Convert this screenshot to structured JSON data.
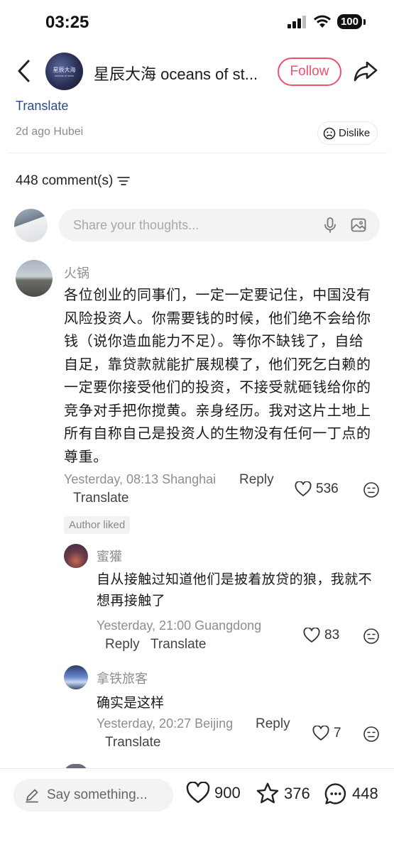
{
  "status_bar": {
    "time": "03:25",
    "battery": "100"
  },
  "header": {
    "avatar_logo_text": "星辰大海",
    "avatar_logo_sub": "oceans of stars",
    "title": "星辰大海 oceans of st...",
    "follow_label": "Follow"
  },
  "post": {
    "translate_label": "Translate",
    "meta": "2d ago Hubei",
    "dislike_label": "Dislike"
  },
  "comments_header": {
    "count_label": "448 comment(s)"
  },
  "composer": {
    "placeholder": "Share your thoughts..."
  },
  "comments": [
    {
      "user": "火锅",
      "body": "各位创业的同事们，一定一定要记住，中国没有风险投资人。你需要钱的时候，他们绝不会给你钱（说你造血能力不足）。等你不缺钱了，自给自足，靠贷款就能扩展规模了，他们死乞白赖的一定要你接受他们的投资，不接受就砸钱给你的竞争对手把你搅黄。亲身经历。我对这片土地上所有自称自己是投资人的生物没有任何一丁点的尊重。",
      "meta": "Yesterday, 08:13 Shanghai",
      "reply_label": "Reply",
      "translate_label": "Translate",
      "likes": "536",
      "author_liked": "Author liked",
      "replies": [
        {
          "user": "蜜獾",
          "body": "自从接触过知道他们是披着放贷的狼，我就不想再接触了",
          "meta": "Yesterday, 21:00 Guangdong",
          "reply_label": "Reply",
          "translate_label": "Translate",
          "likes": "83"
        },
        {
          "user": "拿铁旅客",
          "body": "确实是这样",
          "meta": "Yesterday, 20:27 Beijing",
          "reply_label": "Reply",
          "translate_label": "Translate",
          "likes": "7"
        }
      ]
    }
  ],
  "bottom_bar": {
    "say_placeholder": "Say something...",
    "likes": "900",
    "favorites": "376",
    "comments": "448"
  },
  "colors": {
    "accent": "#f0506e",
    "link": "#2d4b8a",
    "muted": "#8e8e8e"
  }
}
